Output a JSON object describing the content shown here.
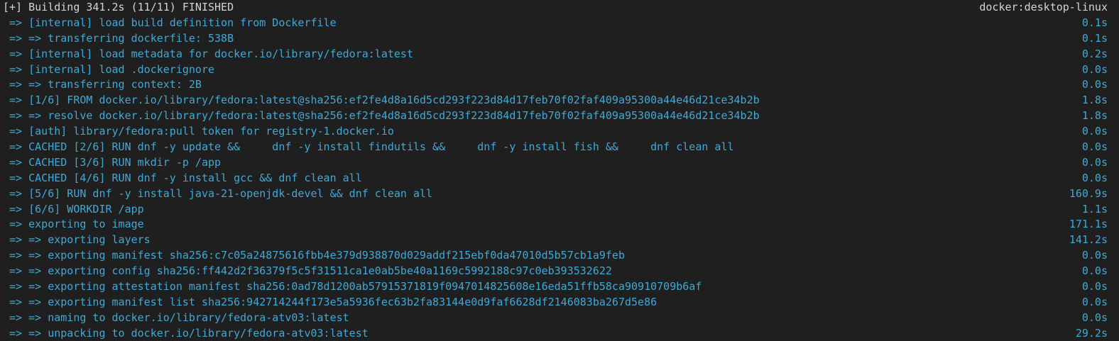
{
  "header": {
    "status": "[+] Building 341.2s (11/11) FINISHED",
    "context": "docker:desktop-linux"
  },
  "steps": [
    {
      "text": " => [internal] load build definition from Dockerfile",
      "time": "0.1s"
    },
    {
      "text": " => => transferring dockerfile: 538B",
      "time": "0.1s"
    },
    {
      "text": " => [internal] load metadata for docker.io/library/fedora:latest",
      "time": "0.2s"
    },
    {
      "text": " => [internal] load .dockerignore",
      "time": "0.0s"
    },
    {
      "text": " => => transferring context: 2B",
      "time": "0.0s"
    },
    {
      "text": " => [1/6] FROM docker.io/library/fedora:latest@sha256:ef2fe4d8a16d5cd293f223d84d17feb70f02faf409a95300a44e46d21ce34b2b",
      "time": "1.8s"
    },
    {
      "text": " => => resolve docker.io/library/fedora:latest@sha256:ef2fe4d8a16d5cd293f223d84d17feb70f02faf409a95300a44e46d21ce34b2b",
      "time": "1.8s"
    },
    {
      "text": " => [auth] library/fedora:pull token for registry-1.docker.io",
      "time": "0.0s"
    },
    {
      "text": " => CACHED [2/6] RUN dnf -y update &&     dnf -y install findutils &&     dnf -y install fish &&     dnf clean all",
      "time": "0.0s"
    },
    {
      "text": " => CACHED [3/6] RUN mkdir -p /app",
      "time": "0.0s"
    },
    {
      "text": " => CACHED [4/6] RUN dnf -y install gcc && dnf clean all",
      "time": "0.0s"
    },
    {
      "text": " => [5/6] RUN dnf -y install java-21-openjdk-devel && dnf clean all",
      "time": "160.9s"
    },
    {
      "text": " => [6/6] WORKDIR /app",
      "time": "1.1s"
    },
    {
      "text": " => exporting to image",
      "time": "171.1s"
    },
    {
      "text": " => => exporting layers",
      "time": "141.2s"
    },
    {
      "text": " => => exporting manifest sha256:c7c05a24875616fbb4e379d938870d029addf215ebf0da47010d5b57cb1a9feb",
      "time": "0.0s"
    },
    {
      "text": " => => exporting config sha256:ff442d2f36379f5c5f31511ca1e0ab5be40a1169c5992188c97c0eb393532622",
      "time": "0.0s"
    },
    {
      "text": " => => exporting attestation manifest sha256:0ad78d1200ab57915371819f0947014825608e16eda51ffb58ca90910709b6af",
      "time": "0.0s"
    },
    {
      "text": " => => exporting manifest list sha256:942714244f173e5a5936fec63b2fa83144e0d9faf6628df2146083ba267d5e86",
      "time": "0.0s"
    },
    {
      "text": " => => naming to docker.io/library/fedora-atv03:latest",
      "time": "0.0s"
    },
    {
      "text": " => => unpacking to docker.io/library/fedora-atv03:latest",
      "time": "29.2s"
    }
  ],
  "colors": {
    "background": "#1f1f1f",
    "header_text": "#d4d4d4",
    "step_text": "#3fa9d6"
  }
}
